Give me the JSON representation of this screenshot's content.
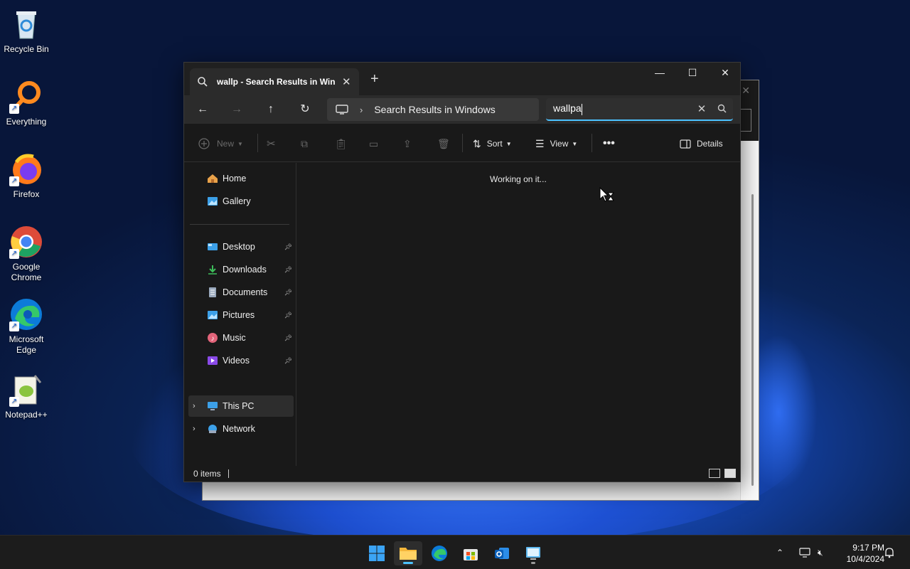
{
  "desktop": {
    "icons": [
      {
        "label": "Recycle Bin"
      },
      {
        "label": "Everything"
      },
      {
        "label": "Firefox"
      },
      {
        "label": "Google Chrome"
      },
      {
        "label": "Microsoft Edge"
      },
      {
        "label": "Notepad++"
      }
    ]
  },
  "explorer": {
    "tab_title": "wallp - Search Results in Wind",
    "address": "Search Results in Windows",
    "search_value": "wallpa",
    "toolbar": {
      "new_label": "New",
      "sort_label": "Sort",
      "view_label": "View",
      "details_label": "Details"
    },
    "sidebar": {
      "home": "Home",
      "gallery": "Gallery",
      "desktop": "Desktop",
      "downloads": "Downloads",
      "documents": "Documents",
      "pictures": "Pictures",
      "music": "Music",
      "videos": "Videos",
      "this_pc": "This PC",
      "network": "Network"
    },
    "status_message": "Working on it...",
    "item_count": "0 items"
  },
  "taskbar": {
    "time": "9:17 PM",
    "date": "10/4/2024"
  },
  "colors": {
    "accent": "#4cc2ff",
    "window_bg": "#191919",
    "navbar_bg": "#2b2b2b"
  }
}
